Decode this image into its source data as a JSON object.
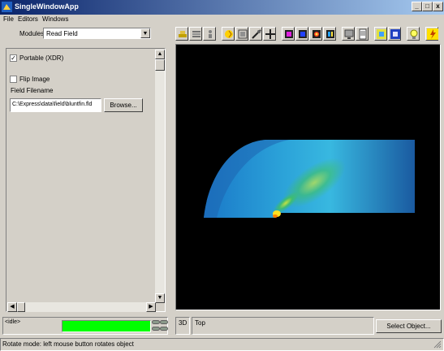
{
  "window": {
    "title": "SingleWindowApp"
  },
  "menu": {
    "items": [
      "File",
      "Editors",
      "Windows"
    ]
  },
  "modules": {
    "label": "Modules",
    "selected": "Read Field"
  },
  "panel": {
    "portable_label": "Portable (XDR)",
    "portable_checked": true,
    "flip_label": "Flip Image",
    "flip_checked": false,
    "field_filename_label": "Field Filename",
    "field_filename_value": "C:\\Express\\data\\field\\bluntfin.fld",
    "browse_label": "Browse..."
  },
  "status": {
    "idle_text": "<idle>"
  },
  "viewer": {
    "mode": "3D",
    "view": "Top",
    "select_object_label": "Select Object..."
  },
  "statusbar": {
    "text": "Rotate mode: left mouse button rotates object"
  },
  "toolbar": {
    "icons": [
      "hat-icon",
      "layers-icon",
      "figure-icon",
      "rotate-icon",
      "frame-icon",
      "split-icon",
      "cross-icon",
      "magenta-cube-icon",
      "blue-cube-icon",
      "red-cube-icon",
      "blue-pair-icon",
      "monitor-icon",
      "document-icon",
      "grid-icon",
      "window-icon",
      "bulb-icon",
      "lightning-icon"
    ]
  },
  "colors": {
    "progress": "#00ff00",
    "viewport": "#000000",
    "title_start": "#0a246a"
  }
}
